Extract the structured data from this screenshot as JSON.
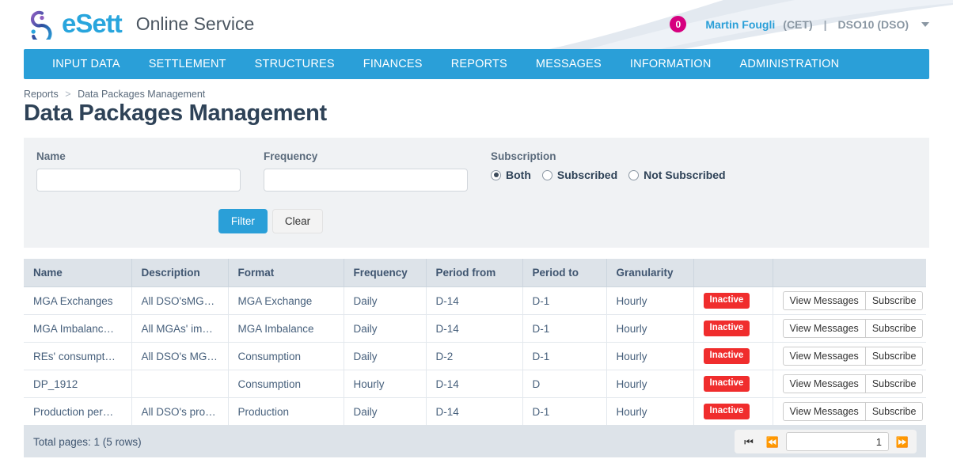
{
  "header": {
    "brand_word": "eSett",
    "brand_sub": "Online Service",
    "logo_icon": "esett-swirl-logo",
    "message_count": "0",
    "user_name": "Martin Fougli",
    "user_timezone": "(CET)",
    "separator": "|",
    "organisation": "DSO10 (DSO)",
    "caret_icon": "chevron-down-icon",
    "accent_color": "#2a9fd8",
    "badge_color": "#d6007f"
  },
  "nav": {
    "items": [
      {
        "label": "INPUT DATA"
      },
      {
        "label": "SETTLEMENT"
      },
      {
        "label": "STRUCTURES"
      },
      {
        "label": "FINANCES"
      },
      {
        "label": "REPORTS"
      },
      {
        "label": "MESSAGES"
      },
      {
        "label": "INFORMATION"
      },
      {
        "label": "ADMINISTRATION"
      }
    ]
  },
  "breadcrumb": {
    "parent": "Reports",
    "separator": ">",
    "current": "Data Packages Management"
  },
  "page_title": "Data Packages Management",
  "filters": {
    "name": {
      "label": "Name",
      "value": "",
      "placeholder": ""
    },
    "frequency": {
      "label": "Frequency",
      "value": "",
      "placeholder": ""
    },
    "subscription": {
      "label": "Subscription",
      "options": [
        {
          "label": "Both",
          "selected": true
        },
        {
          "label": "Subscribed",
          "selected": false
        },
        {
          "label": "Not Subscribed",
          "selected": false
        }
      ]
    },
    "filter_button": "Filter",
    "clear_button": "Clear"
  },
  "table": {
    "columns": [
      "Name",
      "Description",
      "Format",
      "Frequency",
      "Period from",
      "Period to",
      "Granularity",
      "",
      ""
    ],
    "rows": [
      {
        "name": "MGA Exchanges",
        "description": "All DSO'sMGA…",
        "format": "MGA Exchange",
        "frequency": "Daily",
        "period_from": "D-14",
        "period_to": "D-1",
        "granularity": "Hourly",
        "status": "Inactive",
        "view_button": "View Messages",
        "subscribe_button": "Subscribe"
      },
      {
        "name": "MGA Imbalanc…",
        "description": "All MGAs' imb…",
        "format": "MGA Imbalance",
        "frequency": "Daily",
        "period_from": "D-14",
        "period_to": "D-1",
        "granularity": "Hourly",
        "status": "Inactive",
        "view_button": "View Messages",
        "subscribe_button": "Subscribe"
      },
      {
        "name": "REs' consumpt…",
        "description": "All DSO's MG…",
        "format": "Consumption",
        "frequency": "Daily",
        "period_from": "D-2",
        "period_to": "D-1",
        "granularity": "Hourly",
        "status": "Inactive",
        "view_button": "View Messages",
        "subscribe_button": "Subscribe"
      },
      {
        "name": "DP_1912",
        "description": "",
        "format": "Consumption",
        "frequency": "Hourly",
        "period_from": "D-14",
        "period_to": "D",
        "granularity": "Hourly",
        "status": "Inactive",
        "view_button": "View Messages",
        "subscribe_button": "Subscribe"
      },
      {
        "name": "Production per…",
        "description": "All DSO's prod…",
        "format": "Production",
        "frequency": "Daily",
        "period_from": "D-14",
        "period_to": "D-1",
        "granularity": "Hourly",
        "status": "Inactive",
        "view_button": "View Messages",
        "subscribe_button": "Subscribe"
      }
    ],
    "status_color": "#f02d2d"
  },
  "footer": {
    "total_pages": "Total pages: 1 (5 rows)",
    "first_page_icon": "skip-to-first-icon",
    "prev_page_icon": "previous-page-icon",
    "next_page_icon": "next-page-icon",
    "page_value": "1"
  }
}
